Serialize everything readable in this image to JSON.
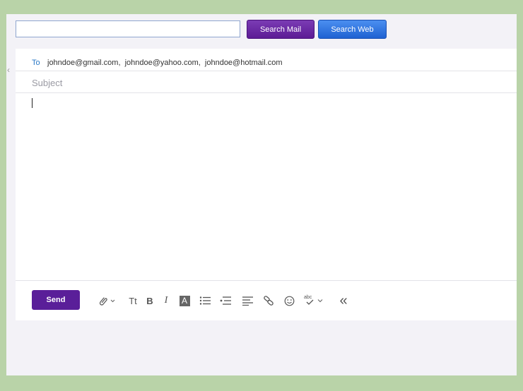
{
  "search": {
    "value": "",
    "search_mail_label": "Search Mail",
    "search_web_label": "Search Web"
  },
  "compose": {
    "to_label": "To",
    "recipients": "johndoe@gmail.com,  johndoe@yahoo.com,  johndoe@hotmail.com",
    "subject_placeholder": "Subject",
    "body": ""
  },
  "toolbar": {
    "send_label": "Send",
    "font_size_glyph": "Tt",
    "bold_glyph": "B",
    "italic_glyph": "I",
    "text_color_glyph": "A",
    "spellcheck_glyph": "abc",
    "collapse_glyph": "«",
    "icons": [
      "paperclip-icon",
      "font-size-icon",
      "bold-icon",
      "italic-icon",
      "text-color-icon",
      "bulleted-list-icon",
      "indent-icon",
      "align-icon",
      "link-icon",
      "emoji-icon",
      "spellcheck-icon",
      "collapse-icon"
    ]
  },
  "colors": {
    "background": "#b9d3a8",
    "search_mail": "#6a2aa8",
    "search_web": "#2e73e0",
    "send": "#5a1f99",
    "to_label": "#2a78c5"
  }
}
